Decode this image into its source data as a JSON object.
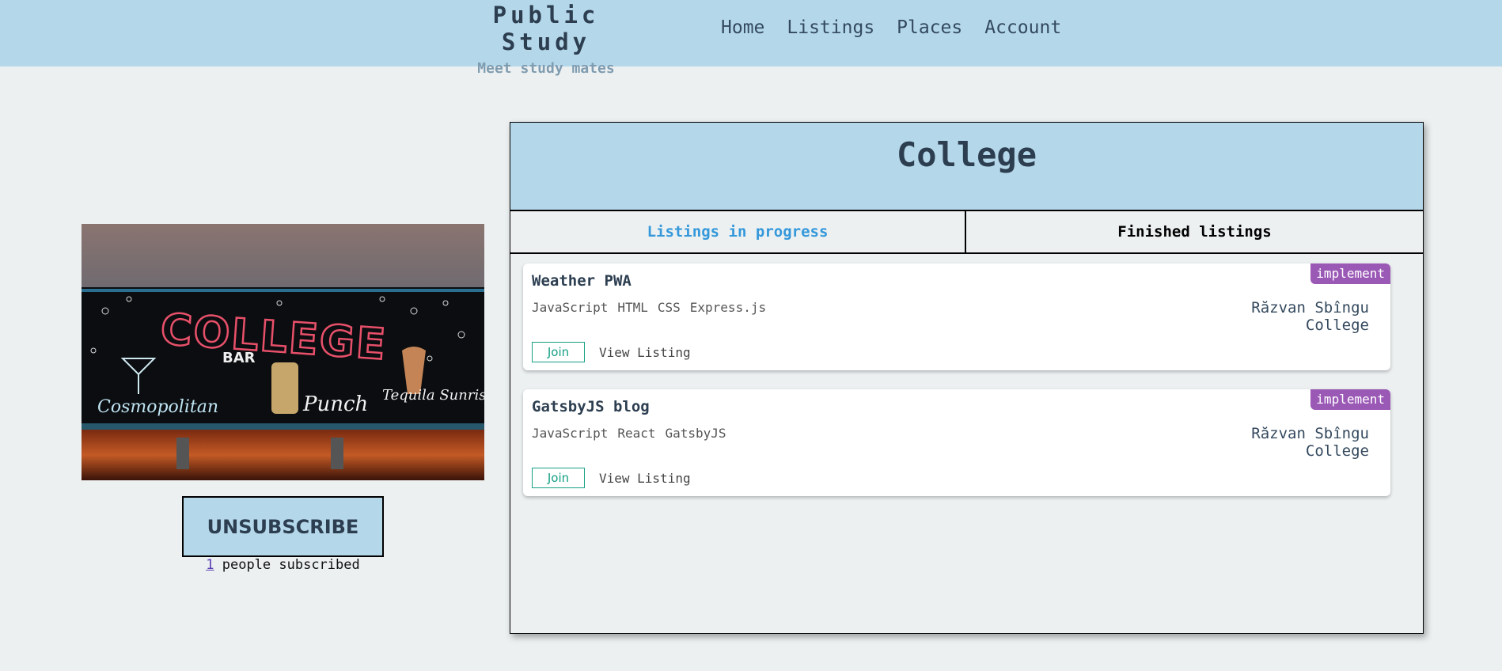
{
  "header": {
    "brand_title": "Public Study",
    "brand_subtitle": "Meet study mates",
    "nav": [
      "Home",
      "Listings",
      "Places",
      "Account"
    ]
  },
  "place": {
    "image_icon": "college-bar-sign-photo",
    "image_text": "COLLEGE",
    "unsubscribe_label": "UNSUBSCRIBE",
    "subscriber_count": "1",
    "subscriber_text": " people subscribed"
  },
  "panel": {
    "title": "College",
    "tabs": [
      "Listings in progress",
      "Finished listings"
    ],
    "active_tab": "Listings in progress"
  },
  "listings": [
    {
      "title": "Weather PWA",
      "badge": "implement",
      "tags": [
        "JavaScript",
        "HTML",
        "CSS",
        "Express.js"
      ],
      "author": "Răzvan Sbîngu",
      "place": "College",
      "join_label": "Join",
      "view_label": "View Listing"
    },
    {
      "title": "GatsbyJS blog",
      "badge": "implement",
      "tags": [
        "JavaScript",
        "React",
        "GatsbyJS"
      ],
      "author": "Răzvan Sbîngu",
      "place": "College",
      "join_label": "Join",
      "view_label": "View Listing"
    }
  ],
  "colors": {
    "header_bg": "#b4d8ea",
    "page_bg": "#ecf0f1",
    "accent_tab": "#3498db",
    "badge": "#9b59b6",
    "join": "#16a085"
  }
}
